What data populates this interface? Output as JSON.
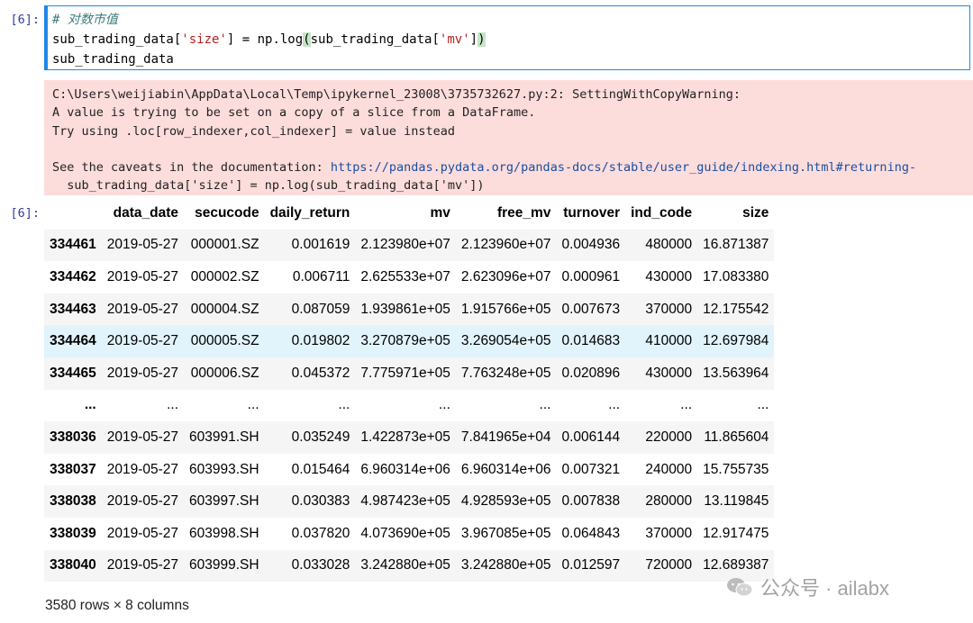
{
  "input_cell": {
    "prompt": "[6]:",
    "comment": "# 对数市值",
    "line2_a": "sub_trading_data[",
    "line2_str1": "'size'",
    "line2_b": "] = np.log",
    "line2_open": "(",
    "line2_c": "sub_trading_data[",
    "line2_str2": "'mv'",
    "line2_d": "]",
    "line2_close": ")",
    "line3": "sub_trading_data"
  },
  "warning": {
    "line1": "C:\\Users\\weijiabin\\AppData\\Local\\Temp\\ipykernel_23008\\3735732627.py:2: SettingWithCopyWarning:",
    "line2": "A value is trying to be set on a copy of a slice from a DataFrame.",
    "line3": "Try using .loc[row_indexer,col_indexer] = value instead",
    "line5_prefix": "See the caveats in the documentation: ",
    "link": "https://pandas.pydata.org/pandas-docs/stable/user_guide/indexing.html#returning-",
    "line6": "  sub_trading_data['size'] = np.log(sub_trading_data['mv'])"
  },
  "output_cell": {
    "prompt": "[6]:"
  },
  "table": {
    "columns": [
      "",
      "data_date",
      "secucode",
      "daily_return",
      "mv",
      "free_mv",
      "turnover",
      "ind_code",
      "size"
    ],
    "rows": [
      [
        "334461",
        "2019-05-27",
        "000001.SZ",
        "0.001619",
        "2.123980e+07",
        "2.123960e+07",
        "0.004936",
        "480000",
        "16.871387"
      ],
      [
        "334462",
        "2019-05-27",
        "000002.SZ",
        "0.006711",
        "2.625533e+07",
        "2.623096e+07",
        "0.000961",
        "430000",
        "17.083380"
      ],
      [
        "334463",
        "2019-05-27",
        "000004.SZ",
        "0.087059",
        "1.939861e+05",
        "1.915766e+05",
        "0.007673",
        "370000",
        "12.175542"
      ],
      [
        "334464",
        "2019-05-27",
        "000005.SZ",
        "0.019802",
        "3.270879e+05",
        "3.269054e+05",
        "0.014683",
        "410000",
        "12.697984"
      ],
      [
        "334465",
        "2019-05-27",
        "000006.SZ",
        "0.045372",
        "7.775971e+05",
        "7.763248e+05",
        "0.020896",
        "430000",
        "13.563964"
      ],
      [
        "...",
        "...",
        "...",
        "...",
        "...",
        "...",
        "...",
        "...",
        "..."
      ],
      [
        "338036",
        "2019-05-27",
        "603991.SH",
        "0.035249",
        "1.422873e+05",
        "7.841965e+04",
        "0.006144",
        "220000",
        "11.865604"
      ],
      [
        "338037",
        "2019-05-27",
        "603993.SH",
        "0.015464",
        "6.960314e+06",
        "6.960314e+06",
        "0.007321",
        "240000",
        "15.755735"
      ],
      [
        "338038",
        "2019-05-27",
        "603997.SH",
        "0.030383",
        "4.987423e+05",
        "4.928593e+05",
        "0.007838",
        "280000",
        "13.119845"
      ],
      [
        "338039",
        "2019-05-27",
        "603998.SH",
        "0.037820",
        "4.073690e+05",
        "3.967085e+05",
        "0.064843",
        "370000",
        "12.917475"
      ],
      [
        "338040",
        "2019-05-27",
        "603999.SH",
        "0.033028",
        "3.242880e+05",
        "3.242880e+05",
        "0.012597",
        "720000",
        "12.689387"
      ]
    ],
    "highlight_row": 3,
    "summary": "3580 rows × 8 columns"
  },
  "watermark": {
    "text": "公众号 · ailabx",
    "icon": "wechat-icon"
  },
  "colors": {
    "prompt": "#303f9f",
    "accent": "#1e88e5",
    "warning_bg": "#fddcdc",
    "string": "#ba2121",
    "comment": "#3d7b7b"
  }
}
